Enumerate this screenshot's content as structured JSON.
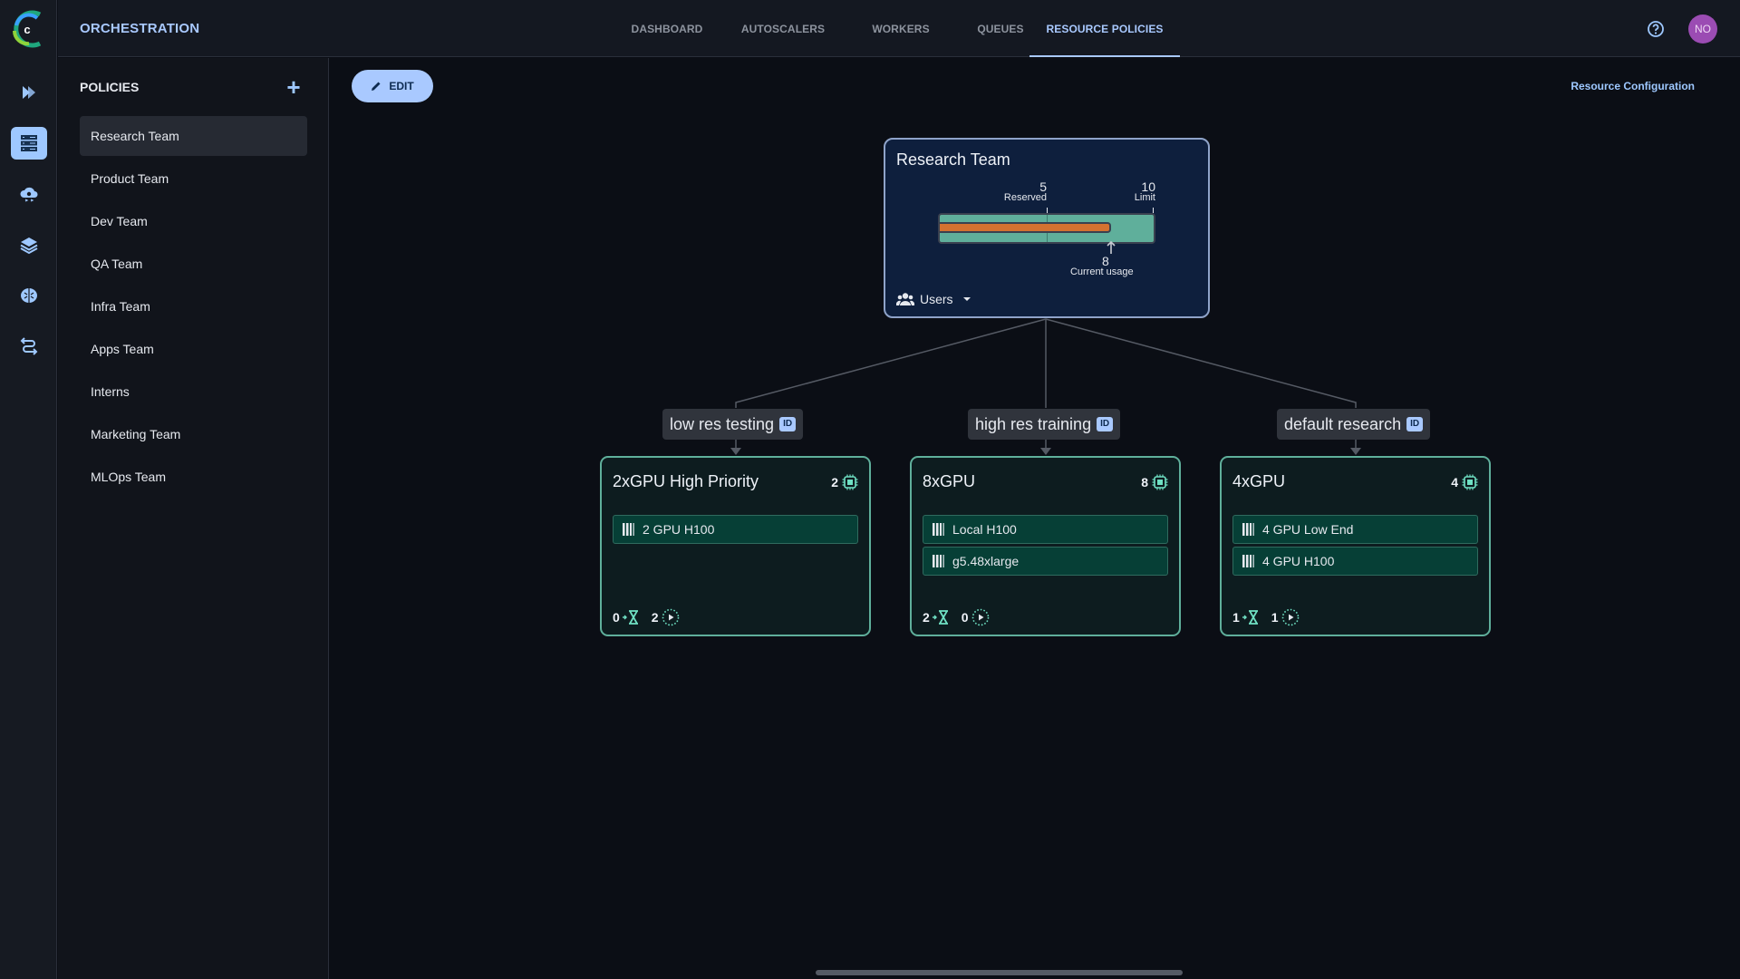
{
  "app": {
    "title": "ORCHESTRATION",
    "avatar_initials": "NO"
  },
  "colors": {
    "accent": "#a9c9ff",
    "avatar": "#9b4cb3",
    "resource_border": "#5faf9b",
    "usage_bar": "#d47230",
    "root_bg": "#0e1f3d"
  },
  "nav": {
    "tabs": [
      {
        "label": "DASHBOARD",
        "active": false
      },
      {
        "label": "AUTOSCALERS",
        "active": false
      },
      {
        "label": "WORKERS",
        "active": false
      },
      {
        "label": "QUEUES",
        "active": false
      },
      {
        "label": "RESOURCE POLICIES",
        "active": true
      }
    ]
  },
  "rail": {
    "items": [
      {
        "icon": "chevron-forward-icon",
        "active": false
      },
      {
        "icon": "server-rack-icon",
        "active": true
      },
      {
        "icon": "cloud-gear-icon",
        "active": false
      },
      {
        "icon": "layers-icon",
        "active": false
      },
      {
        "icon": "brain-icon",
        "active": false
      },
      {
        "icon": "routes-icon",
        "active": false
      }
    ]
  },
  "policies": {
    "heading": "POLICIES",
    "items": [
      {
        "label": "Research Team",
        "active": true
      },
      {
        "label": "Product Team",
        "active": false
      },
      {
        "label": "Dev Team",
        "active": false
      },
      {
        "label": "QA Team",
        "active": false
      },
      {
        "label": "Infra Team",
        "active": false
      },
      {
        "label": "Apps Team",
        "active": false
      },
      {
        "label": "Interns",
        "active": false
      },
      {
        "label": "Marketing Team",
        "active": false
      },
      {
        "label": "MLOps Team",
        "active": false
      }
    ]
  },
  "toolbar": {
    "edit_label": "EDIT",
    "resource_config_label": "Resource Configuration"
  },
  "root_policy": {
    "name": "Research Team",
    "reserved": 5,
    "reserved_label": "Reserved",
    "limit": 10,
    "limit_label": "Limit",
    "current_usage": 8,
    "current_usage_label": "Current usage",
    "users_label": "Users"
  },
  "queues": [
    {
      "label": "low res testing",
      "id_badge": "ID",
      "profile": {
        "name": "2xGPU High Priority",
        "gpus": 2,
        "pools": [
          "2 GPU H100"
        ],
        "pending": 0,
        "running": 2
      }
    },
    {
      "label": "high res training",
      "id_badge": "ID",
      "profile": {
        "name": "8xGPU",
        "gpus": 8,
        "pools": [
          "Local H100",
          "g5.48xlarge"
        ],
        "pending": 2,
        "running": 0
      }
    },
    {
      "label": "default research",
      "id_badge": "ID",
      "profile": {
        "name": "4xGPU",
        "gpus": 4,
        "pools": [
          "4 GPU Low End",
          "4 GPU H100"
        ],
        "pending": 1,
        "running": 1
      }
    }
  ]
}
